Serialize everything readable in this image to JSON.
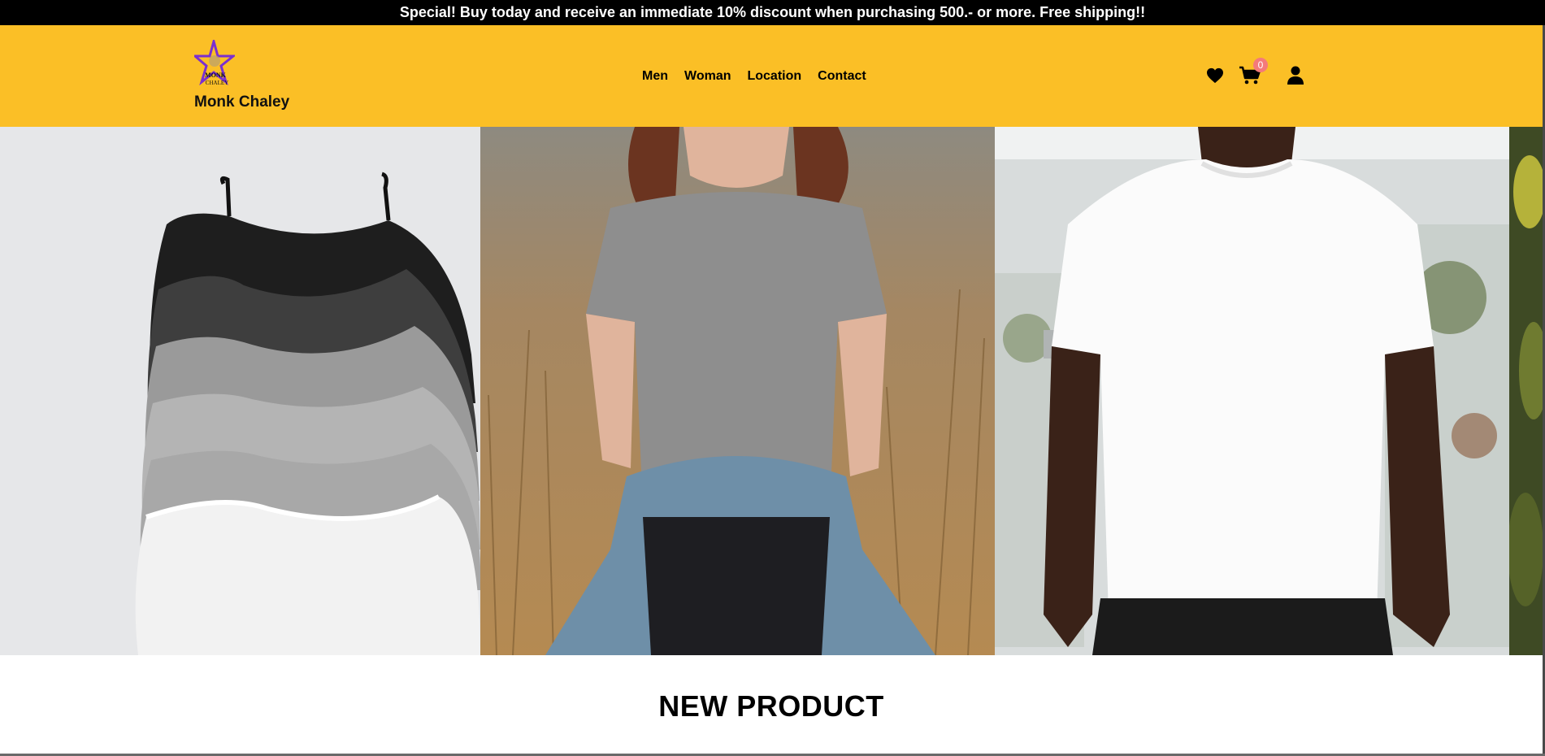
{
  "announcement": "Special! Buy today and receive an immediate 10% discount when purchasing 500.- or more. Free shipping!!",
  "brand": {
    "name": "Monk Chaley",
    "logo_text_line1": "MONK",
    "logo_text_line2": "CHALEY"
  },
  "nav": {
    "links": [
      "Men",
      "Woman",
      "Location",
      "Contact"
    ]
  },
  "header_icons": {
    "wishlist": "heart-icon",
    "cart": "cart-icon",
    "cart_count": "0",
    "account": "user-icon"
  },
  "hero": {
    "slides": [
      "camisole-tops-photo",
      "woman-gray-tee-photo",
      "man-white-tee-photo",
      "plant-photo"
    ]
  },
  "sections": {
    "new_product_title": "NEW PRODUCT"
  },
  "colors": {
    "announcement_bg": "#000000",
    "navbar_bg": "#fbbf26",
    "badge": "#f47a7a",
    "logo_star": "#7b2fd0"
  }
}
